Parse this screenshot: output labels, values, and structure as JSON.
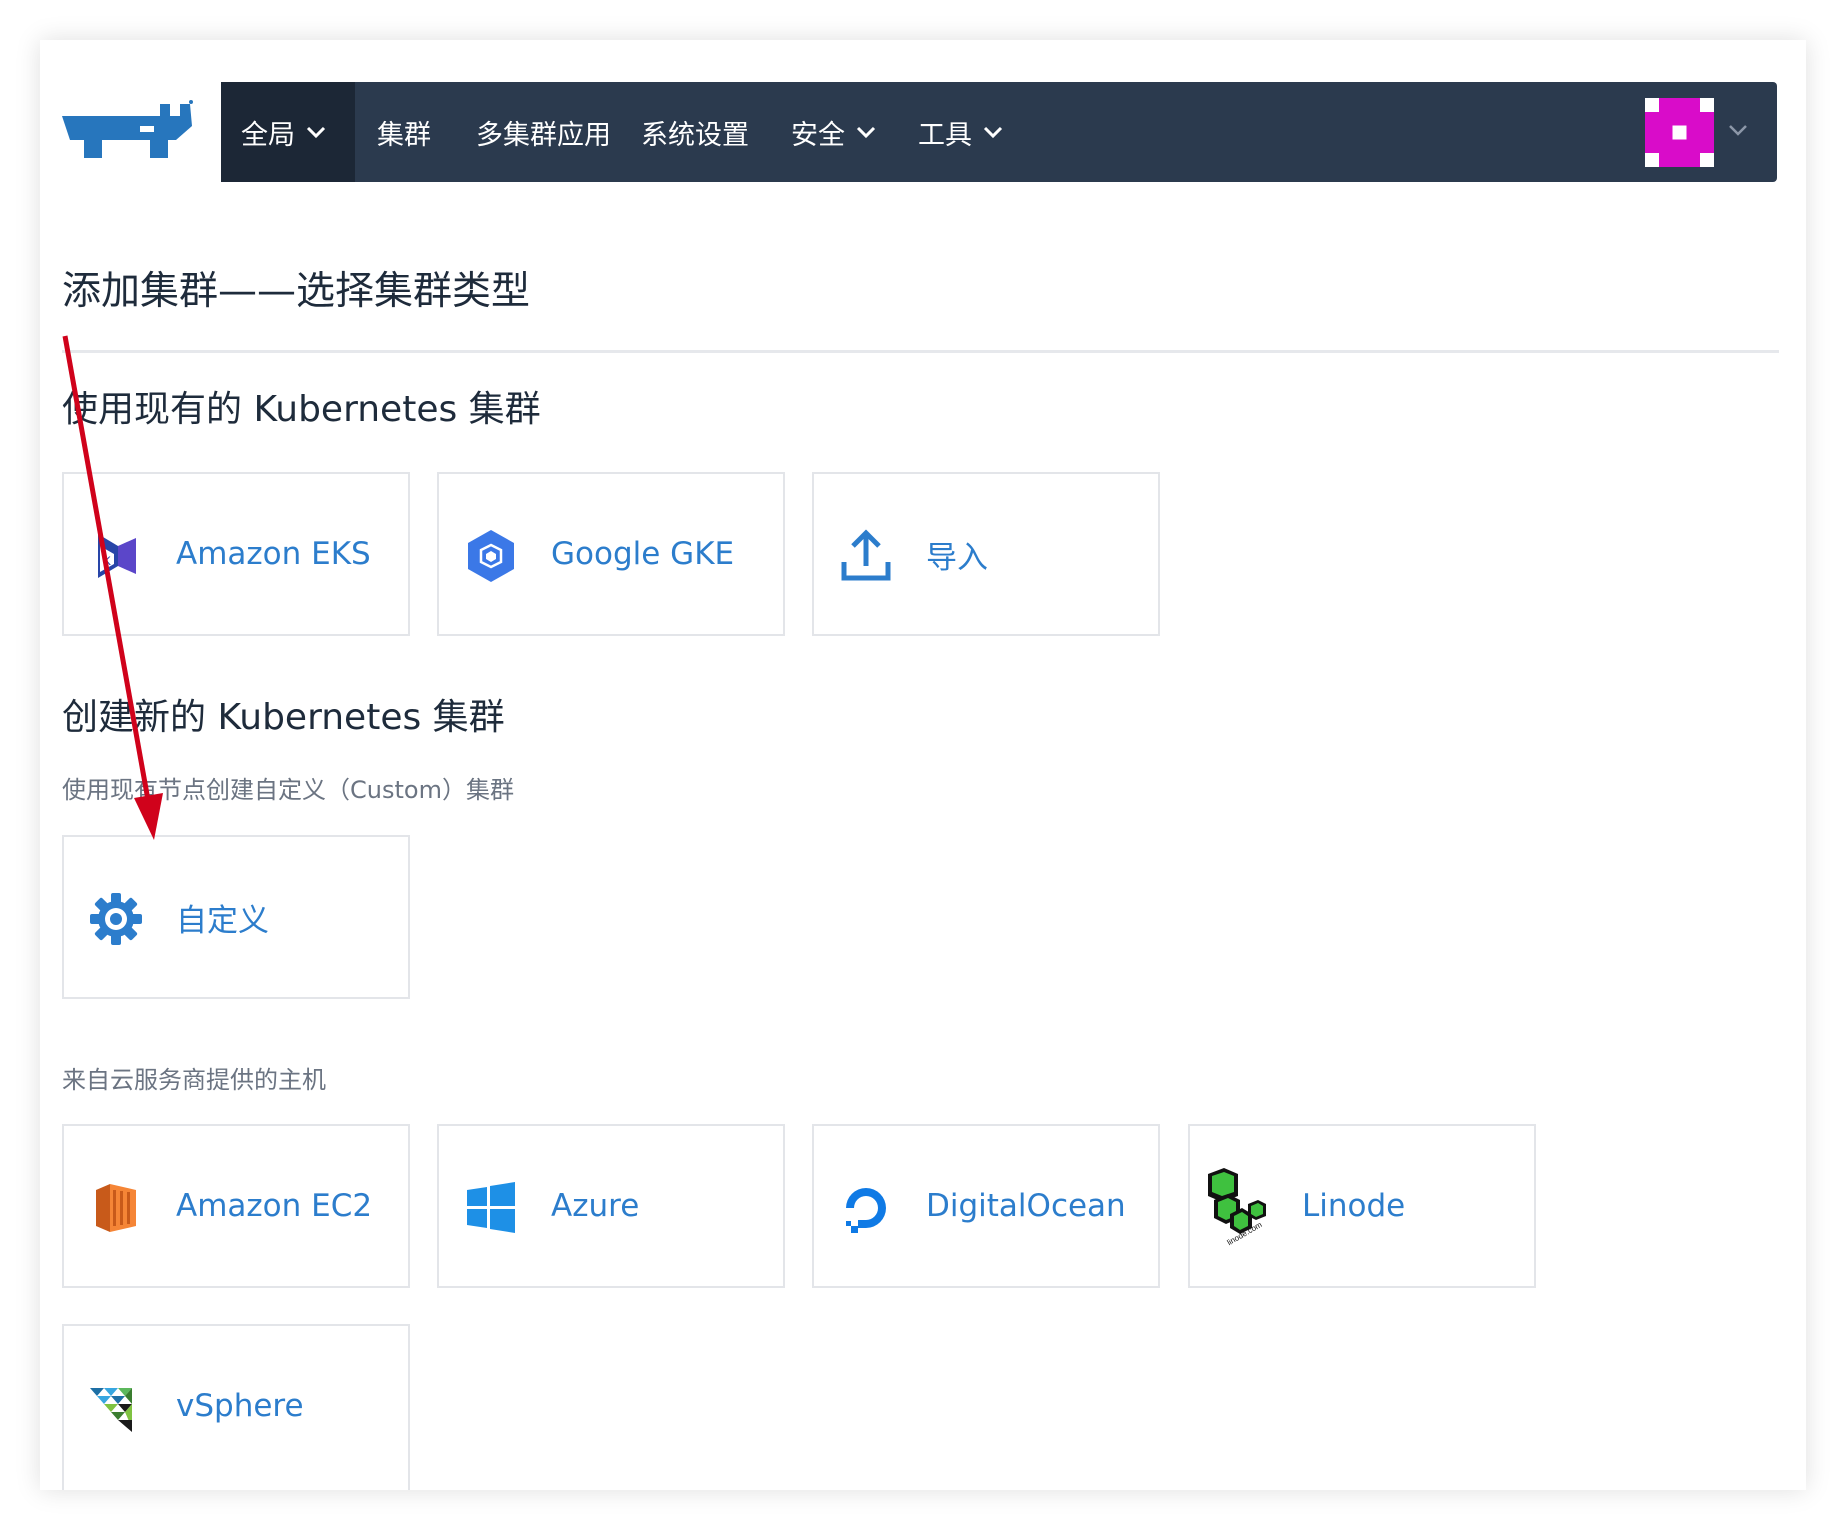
{
  "nav": {
    "items": [
      {
        "label": "全局",
        "has_dropdown": true,
        "active": true
      },
      {
        "label": "集群",
        "has_dropdown": false
      },
      {
        "label": "多集群应用",
        "has_dropdown": false
      },
      {
        "label": "系统设置",
        "has_dropdown": false
      },
      {
        "label": "安全",
        "has_dropdown": true
      },
      {
        "label": "工具",
        "has_dropdown": true
      }
    ],
    "avatar_color": "#d90cc9",
    "bar_color": "#2b3a4e"
  },
  "page": {
    "title": "添加集群——选择集群类型"
  },
  "sections": {
    "existing": {
      "title": "使用现有的 Kubernetes 集群",
      "cards": [
        {
          "label": "Amazon EKS",
          "icon": "amazon-eks-icon"
        },
        {
          "label": "Google GKE",
          "icon": "google-gke-icon"
        },
        {
          "label": "导入",
          "icon": "upload-icon"
        }
      ]
    },
    "create": {
      "title": "创建新的 Kubernetes 集群",
      "custom_subtitle": "使用现有节点创建自定义（Custom）集群",
      "custom_card": {
        "label": "自定义",
        "icon": "gear-icon"
      },
      "cloud_subtitle": "来自云服务商提供的主机",
      "cloud_cards": [
        {
          "label": "Amazon EC2",
          "icon": "amazon-ec2-icon"
        },
        {
          "label": "Azure",
          "icon": "azure-icon"
        },
        {
          "label": "DigitalOcean",
          "icon": "digitalocean-icon"
        },
        {
          "label": "Linode",
          "icon": "linode-icon"
        },
        {
          "label": "vSphere",
          "icon": "vsphere-icon"
        }
      ]
    }
  },
  "accent_color": "#2c7dcc",
  "annotation_arrow_color": "#d0021b"
}
